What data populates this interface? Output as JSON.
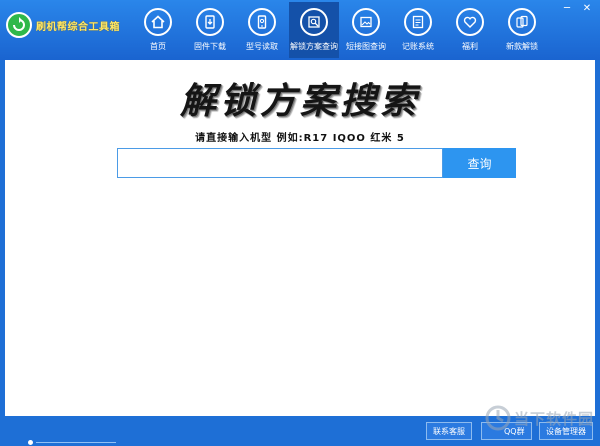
{
  "app": {
    "title": "刷机帮综合工具箱"
  },
  "window_controls": {
    "minimize": "─",
    "close": "✕"
  },
  "nav": [
    {
      "label": "首页",
      "icon": "home-icon"
    },
    {
      "label": "固件下载",
      "icon": "firmware-download-icon"
    },
    {
      "label": "型号读取",
      "icon": "phone-read-icon"
    },
    {
      "label": "解锁方案查询",
      "icon": "unlock-search-icon",
      "active": true
    },
    {
      "label": "短接图查询",
      "icon": "image-icon"
    },
    {
      "label": "记账系统",
      "icon": "ledger-icon"
    },
    {
      "label": "福利",
      "icon": "heart-icon"
    },
    {
      "label": "新款解锁",
      "icon": "new-phone-icon"
    }
  ],
  "main": {
    "title": "解锁方案搜索",
    "subtitle": "请直接输入机型 例如:R17 IQOO 红米 5",
    "search": {
      "value": "",
      "placeholder": "",
      "button": "查询"
    }
  },
  "footer": {
    "buttons": [
      "联系客服",
      "QQ群",
      "设备管理器"
    ]
  },
  "watermark": {
    "text": "当下软件园"
  },
  "colors": {
    "brand_blue": "#1e6fd6",
    "accent": "#2d95f0",
    "logo_green": "#2fb84a",
    "logo_text": "#ffe866"
  }
}
